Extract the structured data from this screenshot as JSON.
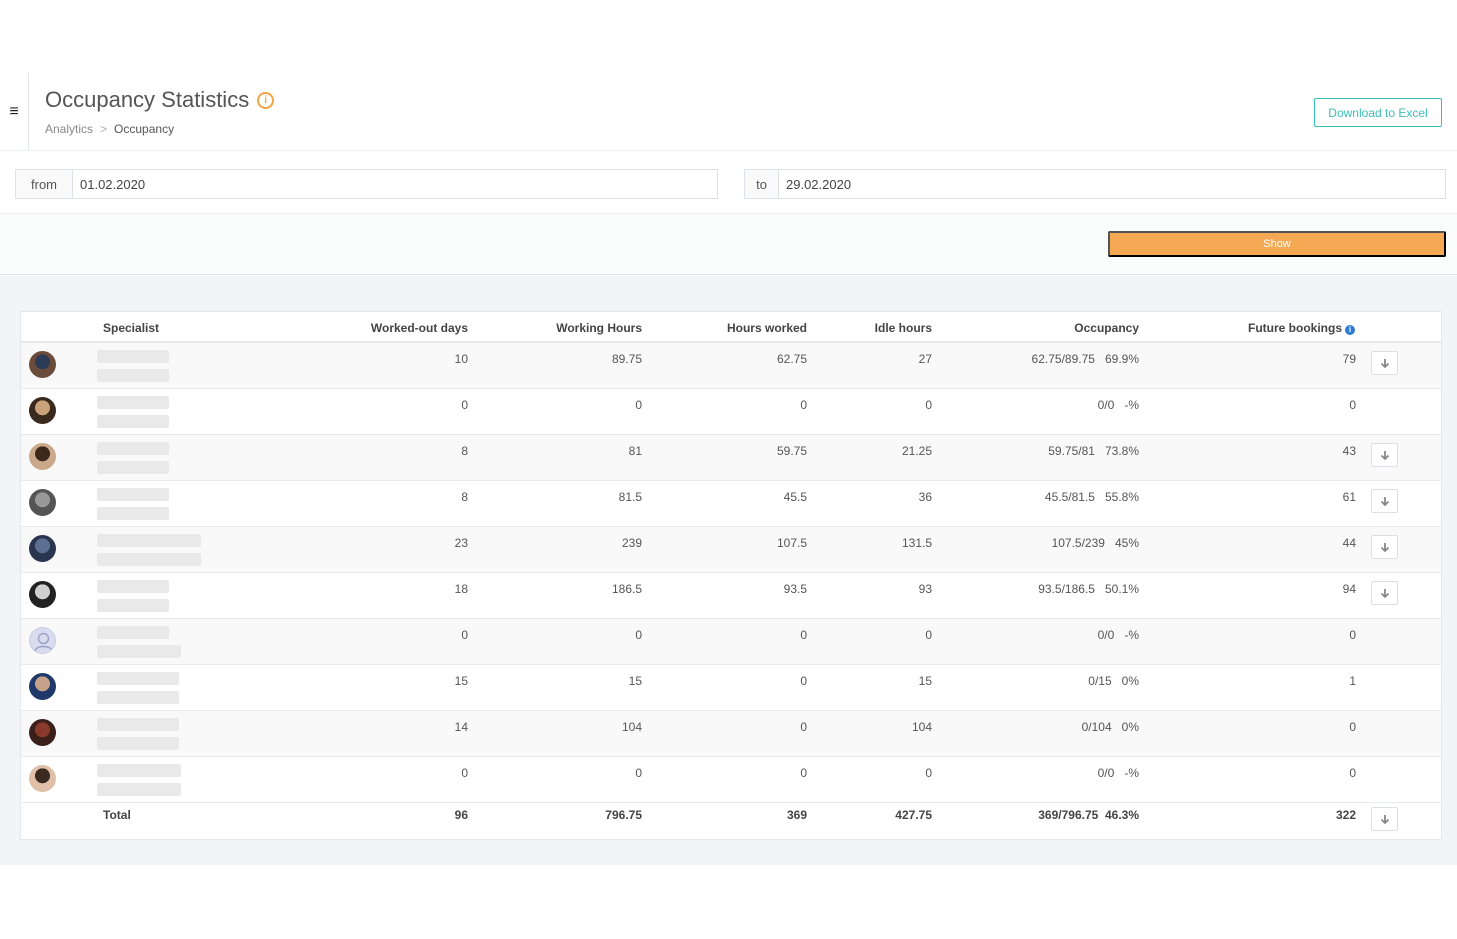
{
  "header": {
    "title": "Occupancy Statistics",
    "breadcrumb": [
      "Analytics",
      "Occupancy"
    ],
    "breadcrumb_sep": ">",
    "download_label": "Download to Excel"
  },
  "filters": {
    "from_label": "from",
    "from_value": "01.02.2020",
    "to_label": "to",
    "to_value": "29.02.2020",
    "show_label": "Show"
  },
  "table": {
    "columns": [
      "Specialist",
      "Worked-out days",
      "Working Hours",
      "Hours worked",
      "Idle hours",
      "Occupancy",
      "Future bookings"
    ],
    "rows": [
      {
        "days": "10",
        "working": "89.75",
        "worked": "62.75",
        "idle": "27",
        "occ_ratio": "62.75/89.75",
        "occ_pct": "69.9%",
        "future": "79",
        "download": true
      },
      {
        "days": "0",
        "working": "0",
        "worked": "0",
        "idle": "0",
        "occ_ratio": "0/0",
        "occ_pct": "-%",
        "future": "0",
        "download": false
      },
      {
        "days": "8",
        "working": "81",
        "worked": "59.75",
        "idle": "21.25",
        "occ_ratio": "59.75/81",
        "occ_pct": "73.8%",
        "future": "43",
        "download": true
      },
      {
        "days": "8",
        "working": "81.5",
        "worked": "45.5",
        "idle": "36",
        "occ_ratio": "45.5/81.5",
        "occ_pct": "55.8%",
        "future": "61",
        "download": true
      },
      {
        "days": "23",
        "working": "239",
        "worked": "107.5",
        "idle": "131.5",
        "occ_ratio": "107.5/239",
        "occ_pct": "45%",
        "future": "44",
        "download": true
      },
      {
        "days": "18",
        "working": "186.5",
        "worked": "93.5",
        "idle": "93",
        "occ_ratio": "93.5/186.5",
        "occ_pct": "50.1%",
        "future": "94",
        "download": true
      },
      {
        "days": "0",
        "working": "0",
        "worked": "0",
        "idle": "0",
        "occ_ratio": "0/0",
        "occ_pct": "-%",
        "future": "0",
        "download": false
      },
      {
        "days": "15",
        "working": "15",
        "worked": "0",
        "idle": "15",
        "occ_ratio": "0/15",
        "occ_pct": "0%",
        "future": "1",
        "download": false
      },
      {
        "days": "14",
        "working": "104",
        "worked": "0",
        "idle": "104",
        "occ_ratio": "0/104",
        "occ_pct": "0%",
        "future": "0",
        "download": false
      },
      {
        "days": "0",
        "working": "0",
        "worked": "0",
        "idle": "0",
        "occ_ratio": "0/0",
        "occ_pct": "-%",
        "future": "0",
        "download": false
      }
    ],
    "total": {
      "label": "Total",
      "days": "96",
      "working": "796.75",
      "worked": "369",
      "idle": "427.75",
      "occ_ratio": "369/796.75",
      "occ_pct": "46.3%",
      "future": "322"
    }
  },
  "colors": {
    "accent_orange": "#f5a955",
    "accent_teal": "#3bbdb8",
    "info_blue": "#2e7bcf"
  },
  "icons": {
    "menu": "hamburger-icon",
    "title_info": "info-circle-icon",
    "future_info": "info-icon",
    "download": "arrow-down-icon"
  }
}
